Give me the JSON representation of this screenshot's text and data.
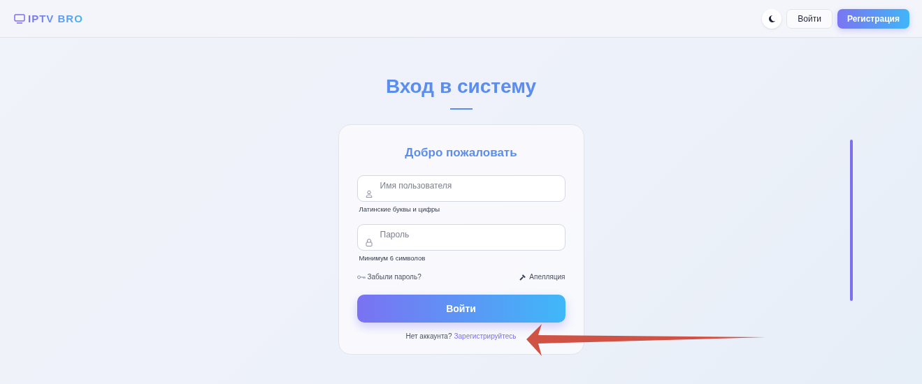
{
  "header": {
    "logo": "IPTV BRO",
    "buttons": [
      "Войти",
      "Регистрация"
    ]
  },
  "title": "Вход в систему",
  "card": {
    "heading": "Добро пожаловать",
    "fields": [
      {
        "kind": "user",
        "placeholder": "Имя пользователя",
        "hint": "Латинские буквы и цифры"
      },
      {
        "kind": "lock",
        "placeholder": "Пароль",
        "hint": "Минимум 6 символов"
      }
    ],
    "forgot_link": "Забыли пароль?",
    "appeal_link": "Апелляция",
    "submit": "Войти",
    "signup_text": "Нет аккаунта?",
    "signup_link": "Зарегистрируйтесь"
  }
}
